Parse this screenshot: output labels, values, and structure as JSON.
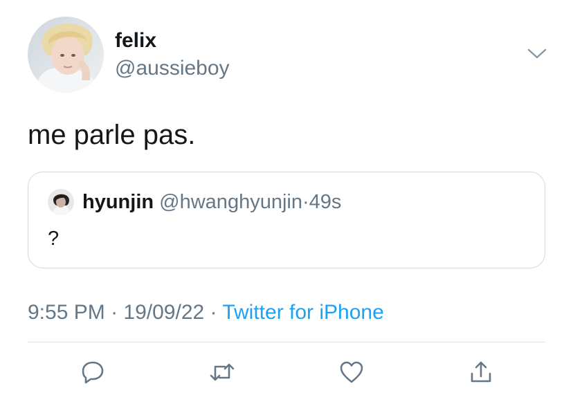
{
  "author": {
    "display_name": "felix",
    "handle": "@aussieboy"
  },
  "tweet": {
    "text": "me parle pas."
  },
  "quoted_tweet": {
    "display_name": "hyunjin",
    "handle": "@hwanghyunjin",
    "separator": "·",
    "time": "49s",
    "text": "?"
  },
  "meta": {
    "time": "9:55 PM",
    "separator": "·",
    "date": "19/09/22",
    "separator2": "·",
    "source": "Twitter for iPhone"
  },
  "icons": {
    "caret": "chevron-down-icon",
    "reply": "reply-icon",
    "retweet": "retweet-icon",
    "like": "heart-icon",
    "share": "share-icon"
  },
  "colors": {
    "text": "#14171a",
    "secondary": "#657786",
    "link": "#1da1f2",
    "border": "#cfd9de"
  }
}
